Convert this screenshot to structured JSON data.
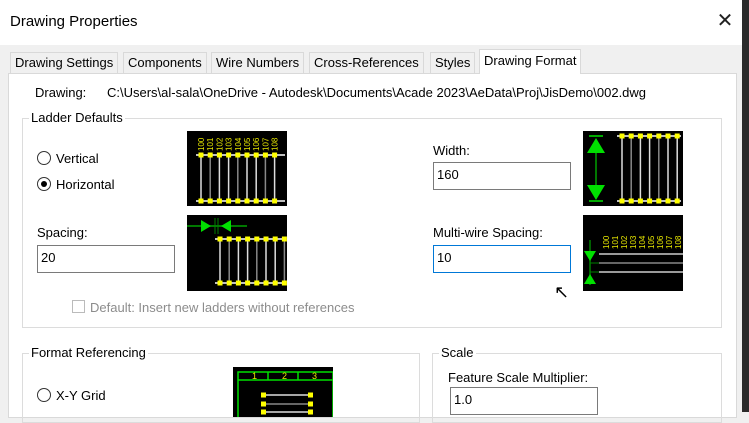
{
  "window": {
    "title": "Drawing Properties",
    "close_icon": "close-icon"
  },
  "tabs": [
    {
      "label": "Drawing Settings"
    },
    {
      "label": "Components"
    },
    {
      "label": "Wire Numbers"
    },
    {
      "label": "Cross-References"
    },
    {
      "label": "Styles"
    },
    {
      "label": "Drawing Format",
      "active": true
    }
  ],
  "drawing": {
    "label": "Drawing:",
    "path": "C:\\Users\\al-sala\\OneDrive - Autodesk\\Documents\\Acade 2023\\AeData\\Proj\\JisDemo\\002.dwg"
  },
  "ladder": {
    "title": "Ladder Defaults",
    "vertical": "Vertical",
    "horizontal": "Horizontal",
    "selected": "Horizontal",
    "width_label": "Width:",
    "width_value": "160",
    "spacing_label": "Spacing:",
    "spacing_value": "20",
    "multiwire_label": "Multi-wire Spacing:",
    "multiwire_value": "10",
    "default_checkbox": "Default: Insert new ladders without references",
    "default_checked": false,
    "wire_numbers": [
      "100",
      "101",
      "102",
      "103",
      "104",
      "105",
      "106",
      "107",
      "108"
    ]
  },
  "format_ref": {
    "title": "Format Referencing",
    "xy_grid": "X-Y Grid",
    "grid_columns": [
      "1",
      "2",
      "3"
    ]
  },
  "scale": {
    "title": "Scale",
    "feature_label": "Feature Scale Multiplier:",
    "feature_value": "1.0"
  },
  "colors": {
    "wire_text": "#e6e600",
    "node": "#ffff00",
    "arrow": "#00e000"
  }
}
